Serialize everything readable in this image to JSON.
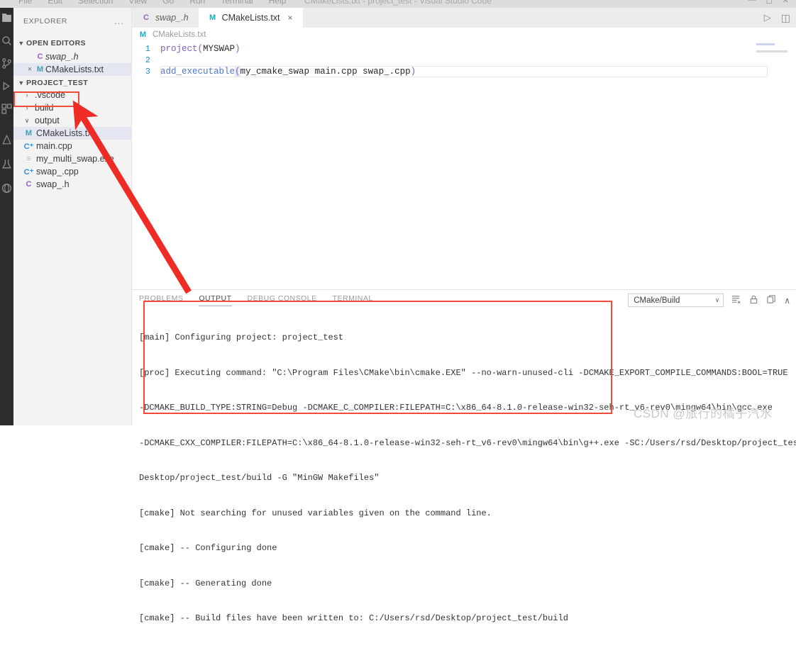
{
  "window": {
    "title": "CMakeLists.txt - project_test - Visual Studio Code",
    "menu": [
      "File",
      "Edit",
      "Selection",
      "View",
      "Go",
      "Run",
      "Terminal",
      "Help"
    ],
    "controls": [
      "minimize",
      "maximize",
      "close"
    ]
  },
  "activity_bar": {
    "items": [
      {
        "name": "explorer-icon",
        "label": "Explorer"
      },
      {
        "name": "search-icon",
        "label": "Search"
      },
      {
        "name": "source-control-icon",
        "label": "Source Control"
      },
      {
        "name": "run-debug-icon",
        "label": "Run and Debug"
      },
      {
        "name": "extensions-icon",
        "label": "Extensions"
      },
      {
        "name": "cmake-icon",
        "label": "CMake"
      },
      {
        "name": "testing-icon",
        "label": "Testing"
      }
    ]
  },
  "sidebar": {
    "title": "EXPLORER",
    "more_label": "...",
    "open_editors": {
      "label": "OPEN EDITORS",
      "expanded": true,
      "items": [
        {
          "name": "swap_.h",
          "icon": "c-header-icon",
          "icon_glyph": "C",
          "icon_class": "c",
          "italic": true,
          "dirty": false,
          "selected": false
        },
        {
          "name": "CMakeLists.txt",
          "icon": "cmake-file-icon",
          "icon_glyph": "M",
          "icon_class": "m",
          "italic": false,
          "dirty": false,
          "selected": true,
          "close_glyph": "×"
        }
      ]
    },
    "project": {
      "label": "PROJECT_TEST",
      "expanded": true,
      "items": [
        {
          "name": ".vscode",
          "type": "folder",
          "expanded": false,
          "twisty": "›",
          "selected": false,
          "highlighted": false
        },
        {
          "name": "build",
          "type": "folder",
          "expanded": false,
          "twisty": "›",
          "selected": false,
          "highlighted": true
        },
        {
          "name": "output",
          "type": "folder",
          "expanded": true,
          "twisty": "∨",
          "selected": false,
          "highlighted": false
        },
        {
          "name": "CMakeLists.txt",
          "type": "file",
          "icon_glyph": "M",
          "icon_class": "m",
          "selected": true,
          "highlighted": false
        },
        {
          "name": "main.cpp",
          "type": "file",
          "icon_glyph": "C⁺",
          "icon_class": "cpp",
          "selected": false,
          "highlighted": false
        },
        {
          "name": "my_multi_swap.exe",
          "type": "file",
          "icon_glyph": "≡",
          "icon_class": "exe",
          "selected": false,
          "highlighted": false
        },
        {
          "name": "swap_.cpp",
          "type": "file",
          "icon_glyph": "C⁺",
          "icon_class": "cpp",
          "selected": false,
          "highlighted": false
        },
        {
          "name": "swap_.h",
          "type": "file",
          "icon_glyph": "C",
          "icon_class": "c",
          "selected": false,
          "highlighted": false
        }
      ]
    }
  },
  "editor": {
    "tabs": [
      {
        "label": "swap_.h",
        "icon_glyph": "C",
        "icon_class": "c",
        "active": false,
        "italic": true
      },
      {
        "label": "CMakeLists.txt",
        "icon_glyph": "M",
        "icon_class": "m",
        "active": true,
        "italic": false,
        "close_glyph": "×"
      }
    ],
    "actions": [
      {
        "name": "run-code-icon",
        "glyph": "▷"
      },
      {
        "name": "split-editor-icon",
        "glyph": "◫"
      }
    ],
    "breadcrumb": {
      "icon_glyph": "M",
      "icon_class": "m",
      "label": "CMakeLists.txt"
    },
    "lines": [
      {
        "number": "1",
        "indent": "  ",
        "tokens": [
          {
            "text": "project",
            "cls": "kw"
          },
          {
            "text": "(",
            "cls": "paren"
          },
          {
            "text": "MYSWAP",
            "cls": "arg"
          },
          {
            "text": ")",
            "cls": "paren"
          }
        ]
      },
      {
        "number": "2",
        "indent": "",
        "tokens": []
      },
      {
        "number": "3",
        "indent": "  ",
        "current": true,
        "tokens": [
          {
            "text": "add_executable",
            "cls": "kw2"
          },
          {
            "text": "(",
            "cls": "paren sel-tok"
          },
          {
            "text": "my_cmake_swap main.cpp swap_.cpp",
            "cls": "arg"
          },
          {
            "text": ")",
            "cls": "paren"
          }
        ]
      }
    ]
  },
  "panel": {
    "tabs": [
      {
        "label": "PROBLEMS",
        "active": false
      },
      {
        "label": "OUTPUT",
        "active": true
      },
      {
        "label": "DEBUG CONSOLE",
        "active": false
      },
      {
        "label": "TERMINAL",
        "active": false
      }
    ],
    "channel_select": {
      "value": "CMake/Build",
      "chevron": "∨"
    },
    "actions": [
      {
        "name": "clear-output-icon",
        "glyph": "≡"
      },
      {
        "name": "lock-icon",
        "glyph": "⌂"
      },
      {
        "name": "split-panel-icon",
        "glyph": "◱"
      },
      {
        "name": "collapse-panel-icon",
        "glyph": "∧"
      }
    ],
    "output_lines": [
      "[main] Configuring project: project_test",
      "[proc] Executing command: \"C:\\Program Files\\CMake\\bin\\cmake.EXE\" --no-warn-unused-cli -DCMAKE_EXPORT_COMPILE_COMMANDS:BOOL=TRUE",
      "-DCMAKE_BUILD_TYPE:STRING=Debug -DCMAKE_C_COMPILER:FILEPATH=C:\\x86_64-8.1.0-release-win32-seh-rt_v6-rev0\\mingw64\\bin\\gcc.exe",
      "-DCMAKE_CXX_COMPILER:FILEPATH=C:\\x86_64-8.1.0-release-win32-seh-rt_v6-rev0\\mingw64\\bin\\g++.exe -SC:/Users/rsd/Desktop/project_test -Bc:/Users/rsd/",
      "Desktop/project_test/build -G \"MinGW Makefiles\"",
      "[cmake] Not searching for unused variables given on the command line.",
      "[cmake] -- Configuring done",
      "[cmake] -- Generating done",
      "[cmake] -- Build files have been written to: C:/Users/rsd/Desktop/project_test/build"
    ]
  },
  "annotations": {
    "color": "#f4493d",
    "build_box_target": "build",
    "output_box_target": "OUTPUT panel",
    "arrow": {
      "from": "output-panel",
      "to": "build-folder"
    }
  },
  "watermark": {
    "text": "CSDN @旅行的橘子汽水"
  }
}
